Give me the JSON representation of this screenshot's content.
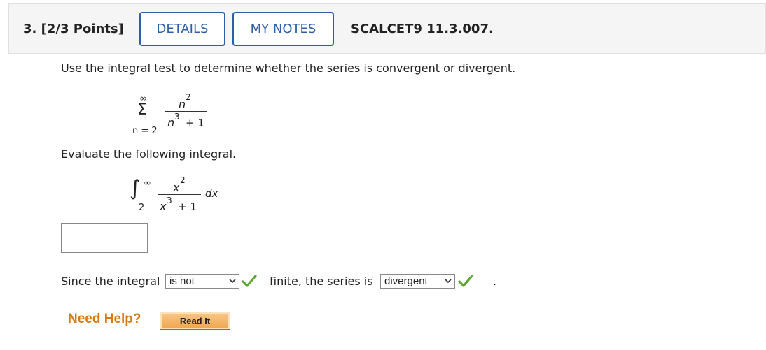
{
  "header": {
    "question_label": "3. [2/3 Points]",
    "details_label": "DETAILS",
    "notes_label": "MY NOTES",
    "code": "SCALCET9 11.3.007."
  },
  "question": {
    "prompt": "Use the integral test to determine whether the series is convergent or divergent.",
    "series": {
      "upper": "∞",
      "sigma": "Σ",
      "lower": "n = 2",
      "numerator_base": "n",
      "numerator_exp": "2",
      "denominator_base": "n",
      "denominator_exp": "3",
      "denominator_rest": "+ 1"
    },
    "evaluate_prompt": "Evaluate the following integral.",
    "integral": {
      "sign": "∫",
      "upper": "∞",
      "lower": "2",
      "numerator_base": "x",
      "numerator_exp": "2",
      "denominator_base": "x",
      "denominator_exp": "3",
      "denominator_rest": "+ 1",
      "differential": "dx"
    },
    "answer_value": "",
    "sentence_part1": "Since the integral",
    "select1_value": "is not",
    "sentence_part2": "finite, the series is",
    "select2_value": "divergent",
    "sentence_end": "."
  },
  "help": {
    "need_help_label": "Need Help?",
    "read_it_label": "Read It"
  },
  "colors": {
    "accent_blue": "#2c5fa8",
    "check_green": "#5aa832",
    "help_orange": "#d87a14"
  },
  "icons": {
    "check": "check-icon",
    "dropdown": "chevron-down-icon"
  }
}
